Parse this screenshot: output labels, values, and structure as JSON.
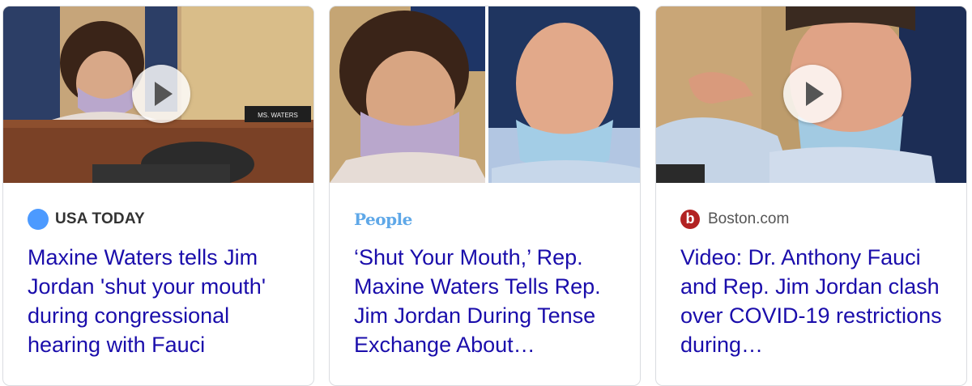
{
  "cards": [
    {
      "source": "USA TODAY",
      "source_icon": "blue-circle-icon",
      "headline": "Maxine Waters tells Jim Jordan 'shut your mouth' during congressional hearing with Fauci",
      "thumbnail_icon": "play-icon"
    },
    {
      "source": "People",
      "source_icon": "people-wordmark",
      "headline": "‘Shut Your Mouth,’ Rep. Maxine Waters Tells Rep. Jim Jordan During Tense Exchange About…",
      "thumbnail_icon": "none"
    },
    {
      "source": "Boston.com",
      "source_icon": "boston-b-icon",
      "source_icon_letter": "b",
      "headline": "Video: Dr. Anthony Fauci and Rep. Jim Jordan clash over COVID-19 restrictions during…",
      "thumbnail_icon": "play-icon"
    }
  ],
  "colors": {
    "headline": "#1a0dab",
    "usa_today_dot": "#4c9aff",
    "people_logo": "#5fa8e8",
    "boston_logo": "#b22222"
  }
}
